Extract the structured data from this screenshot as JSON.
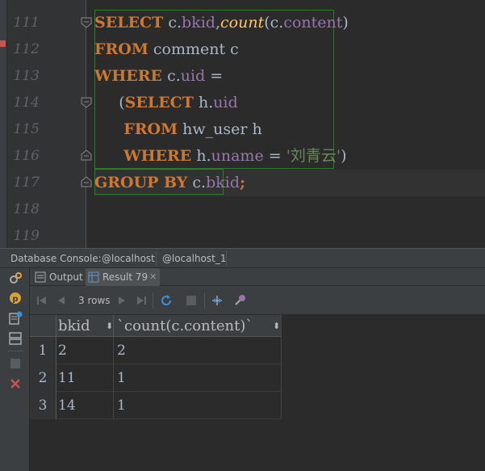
{
  "editor": {
    "line_numbers": [
      "111",
      "112",
      "113",
      "114",
      "115",
      "116",
      "117",
      "118",
      "119"
    ],
    "lines": [
      {
        "tokens": [
          {
            "t": "SELECT",
            "c": "kw"
          },
          {
            "t": " c",
            "c": "plain"
          },
          {
            "t": ".",
            "c": "plain"
          },
          {
            "t": "bkid",
            "c": "fld"
          },
          {
            "t": ",",
            "c": "plain"
          },
          {
            "t": "count",
            "c": "fn"
          },
          {
            "t": "(c",
            "c": "plain"
          },
          {
            "t": ".",
            "c": "plain"
          },
          {
            "t": "content",
            "c": "fld"
          },
          {
            "t": ")",
            "c": "plain"
          }
        ]
      },
      {
        "tokens": [
          {
            "t": "FROM",
            "c": "kw"
          },
          {
            "t": " comment c",
            "c": "plain"
          }
        ]
      },
      {
        "tokens": [
          {
            "t": "WHERE",
            "c": "kw"
          },
          {
            "t": " c",
            "c": "plain"
          },
          {
            "t": ".",
            "c": "plain"
          },
          {
            "t": "uid",
            "c": "fld"
          },
          {
            "t": " =",
            "c": "plain"
          }
        ]
      },
      {
        "tokens": [
          {
            "t": "     (",
            "c": "plain"
          },
          {
            "t": "SELECT",
            "c": "kw"
          },
          {
            "t": " h",
            "c": "plain"
          },
          {
            "t": ".",
            "c": "plain"
          },
          {
            "t": "uid",
            "c": "fld"
          }
        ]
      },
      {
        "tokens": [
          {
            "t": "      ",
            "c": "plain"
          },
          {
            "t": "FROM",
            "c": "kw"
          },
          {
            "t": " hw_user h",
            "c": "plain"
          }
        ]
      },
      {
        "tokens": [
          {
            "t": "      ",
            "c": "plain"
          },
          {
            "t": "WHERE",
            "c": "kw"
          },
          {
            "t": " h",
            "c": "plain"
          },
          {
            "t": ".",
            "c": "plain"
          },
          {
            "t": "uname",
            "c": "fld"
          },
          {
            "t": " = ",
            "c": "plain"
          },
          {
            "t": "'刘青云'",
            "c": "str"
          },
          {
            "t": ")",
            "c": "plain"
          }
        ]
      },
      {
        "tokens": [
          {
            "t": "GROUP BY",
            "c": "kw"
          },
          {
            "t": " c",
            "c": "plain"
          },
          {
            "t": ".",
            "c": "plain"
          },
          {
            "t": "bkid",
            "c": "fld"
          },
          {
            "t": ";",
            "c": "kw"
          }
        ]
      }
    ]
  },
  "console": {
    "title": "Database Console:",
    "tab1": "@localhost",
    "tab2": "@localhost_1"
  },
  "results": {
    "output_tab": "Output",
    "result_tab": "Result 79",
    "rows_label": "3 rows",
    "columns": [
      "bkid",
      "`count(c.content)`"
    ],
    "rows": [
      {
        "num": "1",
        "bkid": "2",
        "count": "2"
      },
      {
        "num": "2",
        "bkid": "11",
        "count": "1"
      },
      {
        "num": "3",
        "bkid": "14",
        "count": "1"
      }
    ]
  },
  "colors": {
    "keyword": "#cc7832",
    "function": "#ffc66d",
    "field": "#9876aa",
    "string": "#6a8759",
    "highlight_box": "#2d7a2d"
  },
  "icons": {
    "left_tools": [
      "settings-icon",
      "p-badge-icon",
      "add-console-icon",
      "layout-icon",
      "stop-icon",
      "close-icon"
    ],
    "toolbar": [
      "first-page-icon",
      "prev-page-icon",
      "next-page-icon",
      "last-page-icon",
      "refresh-icon",
      "stop-icon",
      "pin-icon",
      "settings-icon"
    ]
  }
}
